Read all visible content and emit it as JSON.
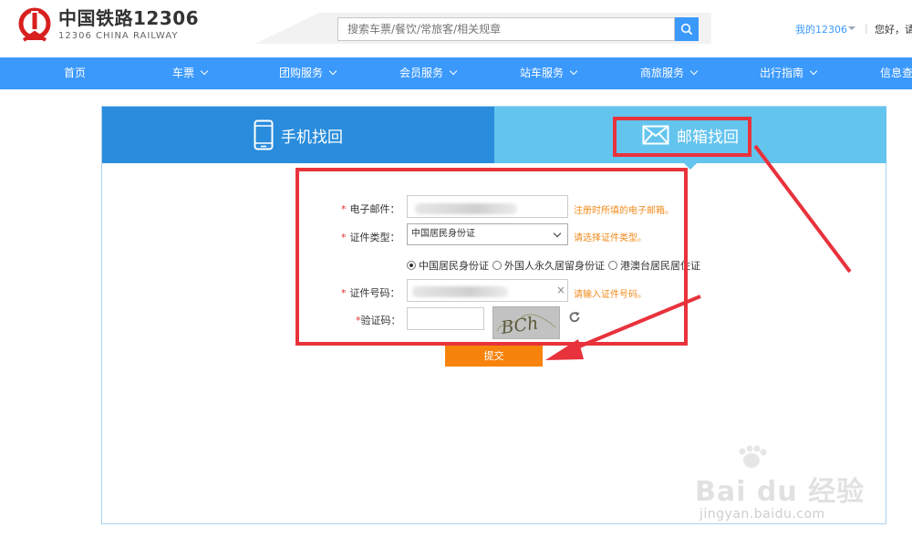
{
  "header": {
    "logo_cn": "中国铁路12306",
    "logo_en": "12306 CHINA RAILWAY",
    "search_placeholder": "搜索车票/餐饮/常旅客/相关规章",
    "my12306": "我的12306",
    "separator": "|",
    "greeting": "您好，请"
  },
  "nav": {
    "items": [
      {
        "label": "首页"
      },
      {
        "label": "车票"
      },
      {
        "label": "团购服务"
      },
      {
        "label": "会员服务"
      },
      {
        "label": "站车服务"
      },
      {
        "label": "商旅服务"
      },
      {
        "label": "出行指南"
      },
      {
        "label": "信息查"
      }
    ]
  },
  "tabs": {
    "phone": "手机找回",
    "email": "邮箱找回"
  },
  "form": {
    "email": {
      "required_mark": "*",
      "label": "电子邮件：",
      "hint": "注册时所填的电子邮箱。"
    },
    "id_type": {
      "required_mark": "*",
      "label": "证件类型：",
      "selected": "中国居民身份证",
      "hint": "请选择证件类型。"
    },
    "id_options": [
      {
        "label": "中国居民身份证",
        "checked": true
      },
      {
        "label": "外国人永久居留身份证",
        "checked": false
      },
      {
        "label": "港澳台居民居住证",
        "checked": false
      }
    ],
    "id_number": {
      "required_mark": "*",
      "label": "证件号码：",
      "clear": "×",
      "hint": "请输入证件号码。"
    },
    "captcha": {
      "required_mark": "*",
      "label": "验证码：",
      "image_text": "BCh"
    },
    "submit": "提交"
  },
  "watermark": {
    "brand": "Bai du 经验",
    "url": "jingyan.baidu.com"
  },
  "colors": {
    "primary_blue": "#3b99fc",
    "tab_active": "#63c4ee",
    "tab_inactive": "#2a8cdc",
    "submit": "#f7830d",
    "hint": "#f08b1c",
    "annotation_red": "#e8323c"
  }
}
